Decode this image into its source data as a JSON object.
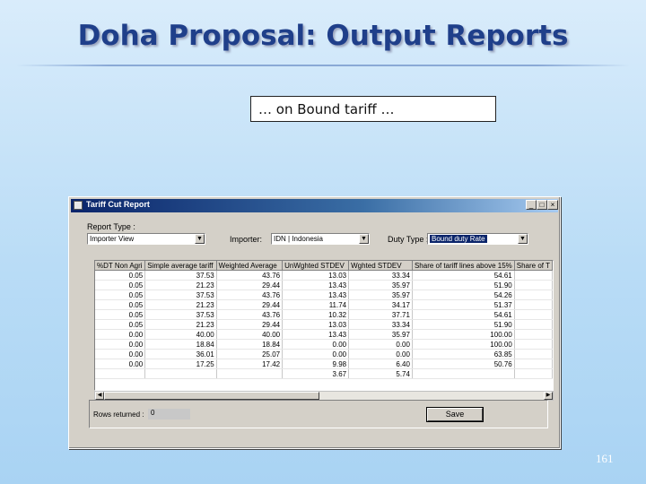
{
  "slide": {
    "title": "Doha Proposal: Output Reports",
    "caption": "… on Bound tariff …",
    "slide_number": "161"
  },
  "window": {
    "title": "Tariff Cut Report",
    "minimize": "_",
    "maximize": "□",
    "close": "×",
    "report_type_label": "Report Type :",
    "report_type_value": "Importer View",
    "importer_label": "Importer:",
    "importer_value": "IDN | Indonesia",
    "duty_type_label": "Duty Type :",
    "duty_type_value": "Bound duty Rate",
    "columns": [
      "%DT Non Agri",
      "Simple average tariff",
      "Weighted Average",
      "UnWghted STDEV",
      "Wghted STDEV",
      "Share of tariff lines above 15%",
      "Share of T"
    ],
    "rows": [
      [
        "0.05",
        "37.53",
        "43.76",
        "13.03",
        "33.34",
        "54.61",
        ""
      ],
      [
        "0.05",
        "21.23",
        "29.44",
        "13.43",
        "35.97",
        "51.90",
        ""
      ],
      [
        "0.05",
        "37.53",
        "43.76",
        "13.43",
        "35.97",
        "54.26",
        ""
      ],
      [
        "0.05",
        "21.23",
        "29.44",
        "11.74",
        "34.17",
        "51.37",
        ""
      ],
      [
        "0.05",
        "37.53",
        "43.76",
        "10.32",
        "37.71",
        "54.61",
        ""
      ],
      [
        "0.05",
        "21.23",
        "29.44",
        "13.03",
        "33.34",
        "51.90",
        ""
      ],
      [
        "0.00",
        "40.00",
        "40.00",
        "13.43",
        "35.97",
        "100.00",
        ""
      ],
      [
        "0.00",
        "18.84",
        "18.84",
        "0.00",
        "0.00",
        "100.00",
        ""
      ],
      [
        "0.00",
        "36.01",
        "25.07",
        "0.00",
        "0.00",
        "63.85",
        ""
      ],
      [
        "0.00",
        "17.25",
        "17.42",
        "9.98",
        "6.40",
        "50.76",
        ""
      ],
      [
        "",
        "",
        "",
        "3.67",
        "5.74",
        "",
        ""
      ]
    ],
    "rows_returned_label": "Rows returned :",
    "rows_returned_value": "0",
    "save_label": "Save"
  }
}
